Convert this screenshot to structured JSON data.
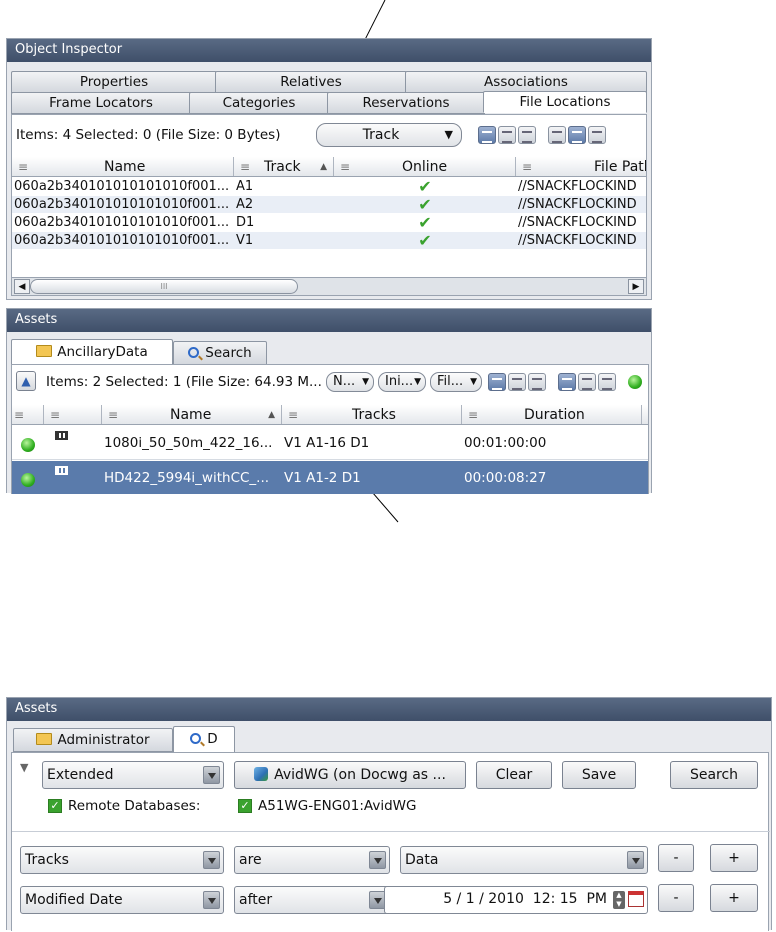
{
  "object_inspector": {
    "title": "Object Inspector",
    "tabs_top": [
      "Properties",
      "Relatives",
      "Associations"
    ],
    "tabs_bottom": [
      "Frame Locators",
      "Categories",
      "Reservations",
      "File Locations"
    ],
    "items_summary": "Items: 4 Selected: 0 (File Size: 0 Bytes)",
    "track_dropdown": "Track",
    "columns": [
      "Name",
      "Track",
      "Online",
      "File Path"
    ],
    "rows": [
      {
        "name": "060a2b340101010101010f001...",
        "track": "A1",
        "path": "//SNACKFLOCKIND"
      },
      {
        "name": "060a2b340101010101010f001...",
        "track": "A2",
        "path": "//SNACKFLOCKIND"
      },
      {
        "name": "060a2b340101010101010f001...",
        "track": "D1",
        "path": "//SNACKFLOCKIND"
      },
      {
        "name": "060a2b340101010101010f001...",
        "track": "V1",
        "path": "//SNACKFLOCKIND"
      }
    ],
    "scroll_mark": "III"
  },
  "assets_top": {
    "title": "Assets",
    "tabs": [
      "AncillaryData",
      "Search"
    ],
    "items_summary": "Items: 2 Selected: 1 (File Size: 64.93 M...",
    "mini_selects": [
      "N...",
      "Ini...",
      "Fil..."
    ],
    "columns": [
      "Name",
      "Tracks",
      "Duration"
    ],
    "rows": [
      {
        "name": "1080i_50_50m_422_16...",
        "tracks": "V1 A1-16 D1",
        "duration": "00:01:00:00",
        "selected": false
      },
      {
        "name": "HD422_5994i_withCC_...",
        "tracks": "V1 A1-2 D1",
        "duration": "00:00:08:27",
        "selected": true
      }
    ]
  },
  "assets_bottom": {
    "title": "Assets",
    "tabs": [
      "Administrator",
      "D"
    ],
    "search_mode": "Extended",
    "database_button": "AvidWG (on Docwg as ...",
    "clear": "Clear",
    "save": "Save",
    "search": "Search",
    "remote_label": "Remote Databases:",
    "remote_db": "A51WG-ENG01:AvidWG",
    "criteria": [
      {
        "field": "Tracks",
        "operator": "are",
        "value": "Data"
      },
      {
        "field": "Modified Date",
        "operator": "after",
        "value": "5 / 1 / 2010  12: 15  PM"
      }
    ],
    "minus": "-",
    "plus": "+"
  },
  "colors": {
    "title_bar": "#4b5b76",
    "selection": "#5a7bab",
    "check": "#3aa22e"
  }
}
